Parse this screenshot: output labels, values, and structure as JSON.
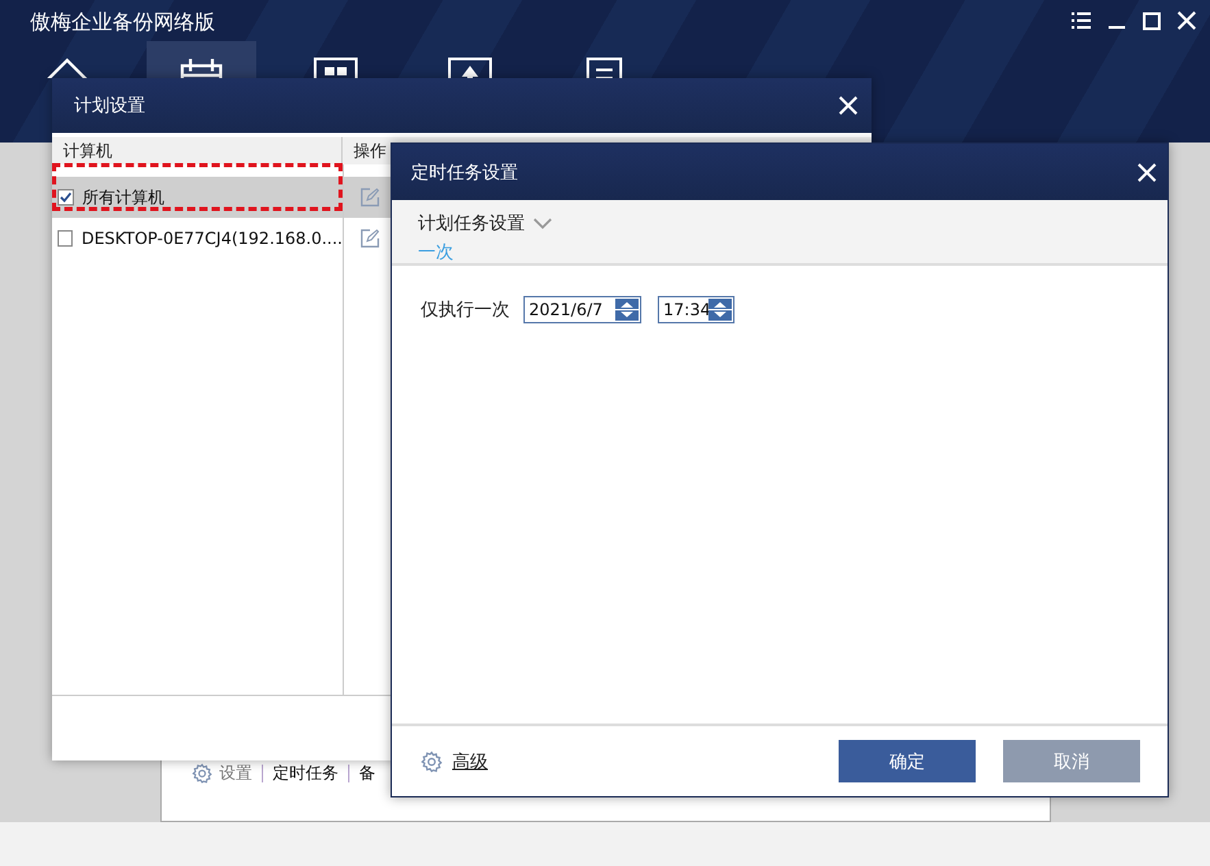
{
  "app": {
    "title": "傲梅企业备份网络版",
    "nav": [
      {
        "kind": "home",
        "selected": false
      },
      {
        "kind": "schedule",
        "selected": true
      },
      {
        "kind": "backup",
        "selected": false
      },
      {
        "kind": "restore",
        "selected": false
      },
      {
        "kind": "tools",
        "selected": false
      }
    ],
    "bottom_tabs": [
      {
        "kind": "settings",
        "label": "设置"
      },
      {
        "kind": "text",
        "label": "定时任务"
      },
      {
        "kind": "text",
        "label": "备"
      }
    ]
  },
  "plan_dialog": {
    "title": "计划设置",
    "columns": [
      "计算机",
      "操作"
    ],
    "rows": [
      {
        "name": "所有计算机",
        "checked": true,
        "selected": true,
        "highlighted": true
      },
      {
        "name": "DESKTOP-0E77CJ4(192.168.0....",
        "checked": false,
        "selected": false,
        "highlighted": false
      }
    ]
  },
  "schedule_dialog": {
    "title": "定时任务设置",
    "section_label": "计划任务设置",
    "section_value": "一次",
    "run_once_label": "仅执行一次",
    "date": "2021/6/7",
    "time": "17:34",
    "advanced": "高级",
    "buttons": [
      {
        "label": "确定",
        "kind": "primary"
      },
      {
        "label": "取消",
        "kind": "secondary"
      }
    ]
  }
}
